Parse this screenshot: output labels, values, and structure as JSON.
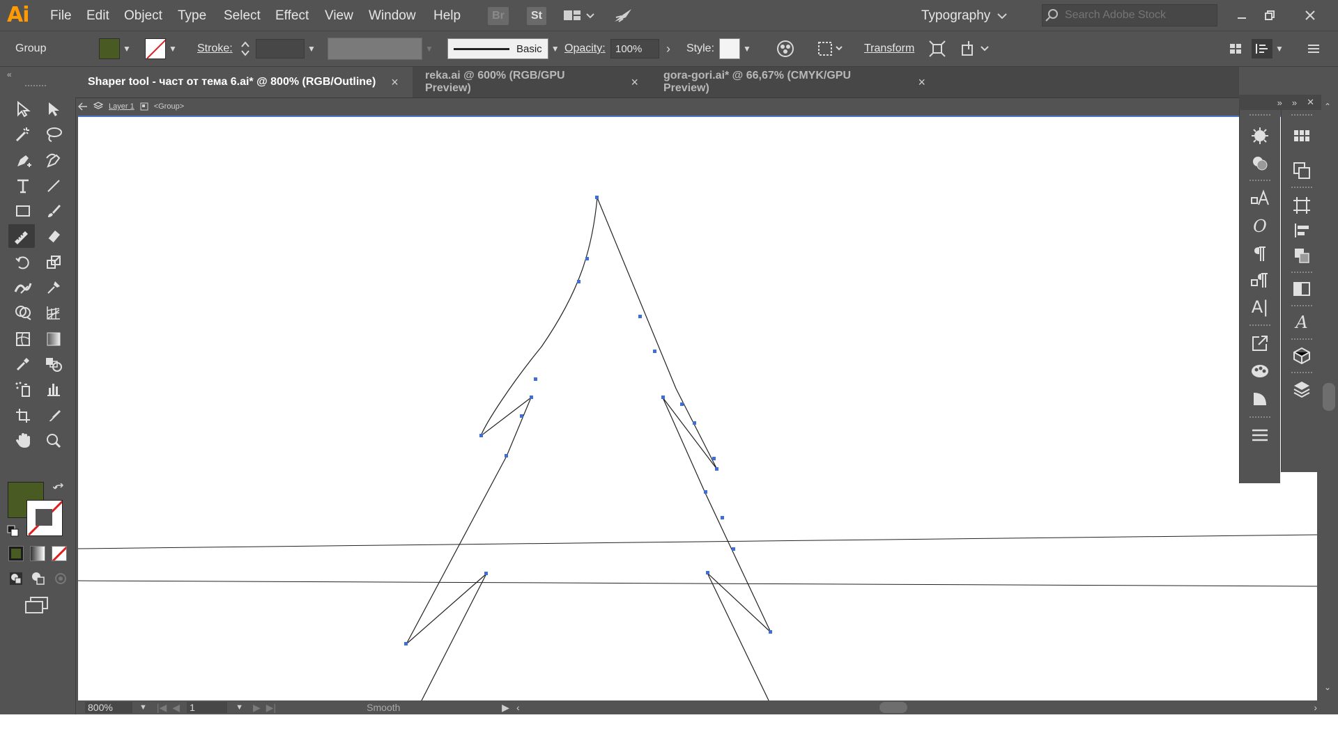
{
  "app": {
    "logo": "Ai"
  },
  "menu": [
    "File",
    "Edit",
    "Object",
    "Type",
    "Select",
    "Effect",
    "View",
    "Window",
    "Help"
  ],
  "menubar": {
    "bridge": "Br",
    "stock": "St",
    "workspace": "Typography",
    "search_placeholder": "Search Adobe Stock"
  },
  "control": {
    "selection": "Group",
    "stroke_label": "Stroke:",
    "brush_name": "Basic",
    "opacity_label": "Opacity:",
    "opacity_value": "100%",
    "style_label": "Style:",
    "transform_label": "Transform"
  },
  "colors": {
    "fill": "#4a5a23",
    "anchor": "#3d6fd6",
    "accent": "#4a78c8"
  },
  "tabs": [
    {
      "title": "Shaper tool - част от тема 6.ai* @ 800% (RGB/Outline)",
      "close": "×"
    },
    {
      "title": "reka.ai @ 600% (RGB/GPU Preview)",
      "close": "×"
    },
    {
      "title": "gora-gori.ai* @ 66,67% (CMYK/GPU Preview)",
      "close": "×"
    }
  ],
  "breadcrumb": {
    "layer": "Layer 1",
    "group": "<Group>"
  },
  "status": {
    "zoom": "800%",
    "artboard": "1",
    "tool": "Smooth"
  },
  "tools": [
    "selection-icon",
    "direct-selection-icon",
    "magic-wand-icon",
    "lasso-icon",
    "pen-icon",
    "curvature-icon",
    "type-icon",
    "line-segment-icon",
    "rectangle-icon",
    "paintbrush-icon",
    "shaper-icon",
    "eraser-icon",
    "rotate-icon",
    "scale-icon",
    "width-icon",
    "puppet-warp-icon",
    "shape-builder-icon",
    "perspective-grid-icon",
    "mesh-icon",
    "gradient-icon",
    "eyedropper-icon",
    "blend-icon",
    "symbol-sprayer-icon",
    "column-graph-icon",
    "artboard-icon",
    "slice-icon",
    "hand-icon",
    "zoom-icon"
  ]
}
